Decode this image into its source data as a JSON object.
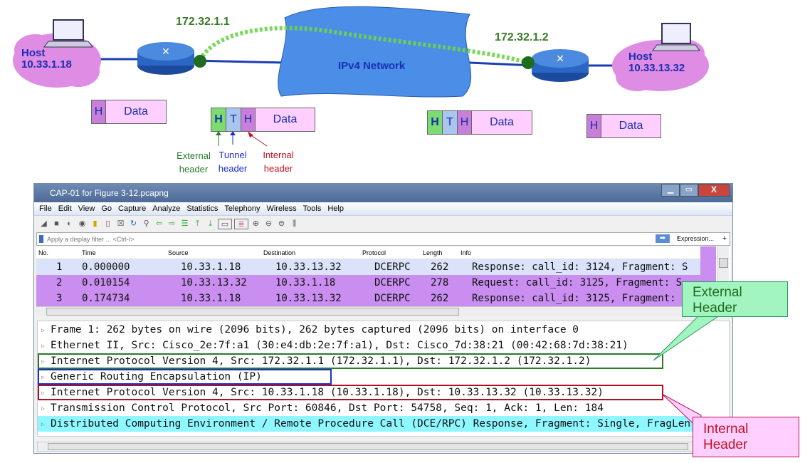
{
  "diagram": {
    "left_host": {
      "label": "Host",
      "ip": "10.33.1.18"
    },
    "right_host": {
      "label": "Host",
      "ip": "10.33.13.32"
    },
    "tunnel_src": "172.32.1.1",
    "tunnel_dst": "172.32.1.2",
    "network": "IPv4 Network",
    "packets": {
      "h": "H",
      "t": "T",
      "data": "Data"
    },
    "annotations": {
      "external": "External header",
      "tunnel": "Tunnel header",
      "internal": "Internal header"
    }
  },
  "window": {
    "title": "CAP-01 for Figure 3-12.pcapng",
    "menu": [
      "File",
      "Edit",
      "View",
      "Go",
      "Capture",
      "Analyze",
      "Statistics",
      "Telephony",
      "Wireless",
      "Tools",
      "Help"
    ],
    "filter_placeholder": "Apply a display filter ... <Ctrl-/>",
    "expression": "Expression...",
    "plus": "+",
    "columns": [
      "No.",
      "Time",
      "Source",
      "Destination",
      "Protocol",
      "Length",
      "Info"
    ],
    "packets": [
      {
        "no": "1",
        "time": "0.000000",
        "src": "10.33.1.18",
        "dst": "10.33.13.32",
        "proto": "DCERPC",
        "len": "262",
        "info": "Response: call_id: 3124, Fragment: S"
      },
      {
        "no": "2",
        "time": "0.010154",
        "src": "10.33.13.32",
        "dst": "10.33.1.18",
        "proto": "DCERPC",
        "len": "278",
        "info": "Request: call_id: 3125, Fragment: S"
      },
      {
        "no": "3",
        "time": "0.174734",
        "src": "10.33.1.18",
        "dst": "10.33.13.32",
        "proto": "DCERPC",
        "len": "262",
        "info": "Response: call_id: 3125, Fragment: S"
      }
    ],
    "details": [
      "Frame 1: 262 bytes on wire (2096 bits), 262 bytes captured (2096 bits) on interface 0",
      "Ethernet II, Src: Cisco_2e:7f:a1 (30:e4:db:2e:7f:a1), Dst: Cisco_7d:38:21 (00:42:68:7d:38:21)",
      "Internet Protocol Version 4, Src: 172.32.1.1 (172.32.1.1), Dst: 172.32.1.2 (172.32.1.2)",
      "Generic Routing Encapsulation (IP)",
      "Internet Protocol Version 4, Src: 10.33.1.18 (10.33.1.18), Dst: 10.33.13.32 (10.33.13.32)",
      "Transmission Control Protocol, Src Port: 60846, Dst Port: 54758, Seq: 1, Ack: 1, Len: 184",
      "Distributed Computing Environment / Remote Procedure Call (DCE/RPC) Response, Fragment: Single, FragLen"
    ]
  },
  "callouts": {
    "external": [
      "External",
      "Header"
    ],
    "internal": [
      "Internal",
      "Header"
    ]
  },
  "colors": {
    "external": "#2a7a2a",
    "tunnel": "#1a2fd0",
    "internal": "#b01020",
    "dcerpc_row": "#c98ef0",
    "highlight": "#8ff7ff"
  }
}
